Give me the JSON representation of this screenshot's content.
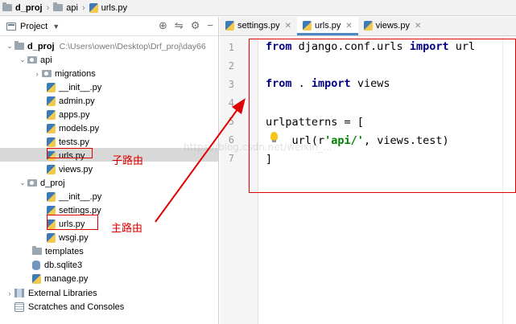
{
  "breadcrumb": [
    {
      "label": "d_proj",
      "icon": "folder-icon"
    },
    {
      "label": "api",
      "icon": "folder-icon"
    },
    {
      "label": "urls.py",
      "icon": "python-file-icon"
    }
  ],
  "project_panel": {
    "title": "Project",
    "tools": [
      "target-icon",
      "collapse-icon",
      "gear-icon",
      "minimize-icon"
    ],
    "root": {
      "name": "d_proj",
      "path": "C:\\Users\\owen\\Desktop\\Drf_proj\\day66"
    },
    "tree": [
      {
        "label": "api",
        "icon": "folder"
      },
      {
        "label": "migrations",
        "icon": "folder"
      },
      {
        "label": "__init__.py",
        "icon": "python"
      },
      {
        "label": "admin.py",
        "icon": "python"
      },
      {
        "label": "apps.py",
        "icon": "python"
      },
      {
        "label": "models.py",
        "icon": "python"
      },
      {
        "label": "tests.py",
        "icon": "python"
      },
      {
        "label": "urls.py",
        "icon": "python"
      },
      {
        "label": "views.py",
        "icon": "python"
      },
      {
        "label": "d_proj",
        "icon": "folder"
      },
      {
        "label": "__init__.py",
        "icon": "python"
      },
      {
        "label": "settings.py",
        "icon": "python"
      },
      {
        "label": "urls.py",
        "icon": "python"
      },
      {
        "label": "wsgi.py",
        "icon": "python"
      },
      {
        "label": "templates",
        "icon": "folder"
      },
      {
        "label": "db.sqlite3",
        "icon": "database"
      },
      {
        "label": "manage.py",
        "icon": "python"
      },
      {
        "label": "External Libraries",
        "icon": "library"
      },
      {
        "label": "Scratches and Consoles",
        "icon": "scratch"
      }
    ]
  },
  "annotations": {
    "sub_route": "子路由",
    "main_route": "主路由"
  },
  "editor": {
    "tabs": [
      {
        "label": "settings.py"
      },
      {
        "label": "urls.py",
        "active": true
      },
      {
        "label": "views.py"
      }
    ],
    "line_numbers": [
      "1",
      "2",
      "3",
      "4",
      "5",
      "6",
      "7"
    ],
    "code": {
      "l1_kw1": "from",
      "l1_mod": " django.conf.urls ",
      "l1_kw2": "import",
      "l1_name": " url",
      "l3_kw1": "from",
      "l3_mod": " . ",
      "l3_kw2": "import",
      "l3_name": " views",
      "l5": "urlpatterns = [",
      "l6_a": "    url(r",
      "l6_str": "'api/'",
      "l6_b": ", views.test)",
      "l7": "]"
    },
    "watermark": "https://blog.csdn.net/weixin_..."
  },
  "colors": {
    "highlight": "#e00000",
    "keyword": "#000080",
    "string": "#008000",
    "tab_accent": "#4a88c7"
  }
}
